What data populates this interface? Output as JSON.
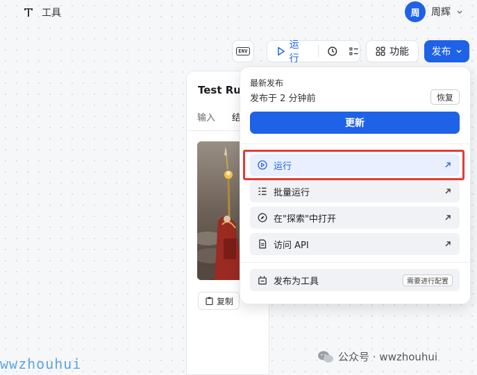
{
  "header": {
    "brand_label": "工具",
    "user_avatar_text": "周",
    "user_name": "周辉"
  },
  "toolbar": {
    "env_badge": "ENV",
    "run_label": "运行",
    "function_label": "功能",
    "publish_label": "发布"
  },
  "card": {
    "title": "Test Ru",
    "tabs": [
      "输入",
      "结"
    ],
    "copy_label": "复制"
  },
  "publish_menu": {
    "latest_label": "最新发布",
    "published_time": "发布于 2 分钟前",
    "restore_label": "恢复",
    "update_label": "更新",
    "items": [
      {
        "label": "运行",
        "icon": "play-circle-icon"
      },
      {
        "label": "批量运行",
        "icon": "list-icon"
      },
      {
        "label": "在\"探索\"中打开",
        "icon": "compass-icon"
      },
      {
        "label": "访问 API",
        "icon": "document-icon"
      }
    ],
    "tool_item": {
      "label": "发布为工具",
      "badge": "需要进行配置"
    }
  },
  "watermark": {
    "left": "wwzhouhui",
    "right": "公众号 · wwzhouhui"
  },
  "colors": {
    "primary": "#1e62e8",
    "highlight_border": "#e53935"
  }
}
